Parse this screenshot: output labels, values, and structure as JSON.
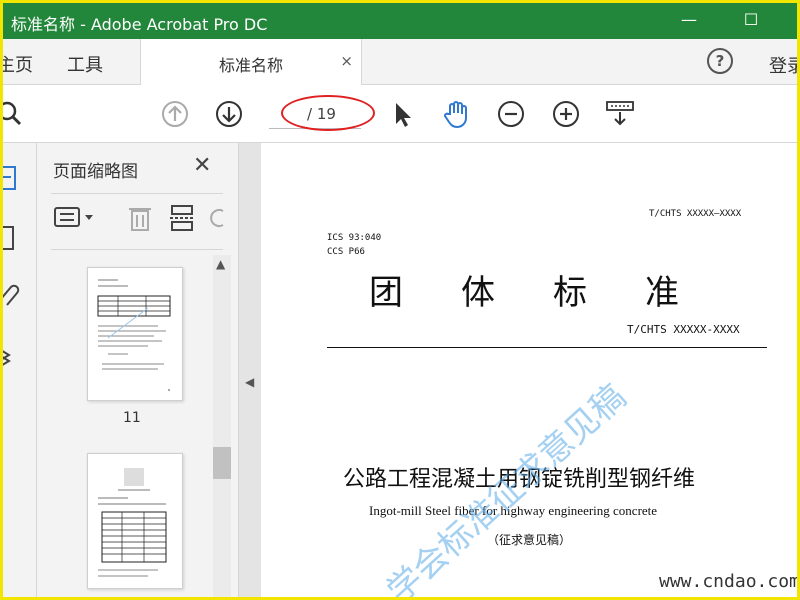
{
  "window": {
    "title": "标准名称 - Adobe Acrobat Pro DC",
    "minimize": "—",
    "maximize": "☐"
  },
  "tabs": {
    "home": "主页",
    "tools": "工具",
    "document": "标准名称",
    "close": "×",
    "help": "?",
    "login": "登录"
  },
  "toolbar": {
    "page_total": "/ 19"
  },
  "panel": {
    "title": "页面缩略图",
    "close": "✕",
    "thumbnails": [
      {
        "label": "11"
      }
    ]
  },
  "document": {
    "code_top": "T/CHTS XXXXX—XXXX",
    "ics": "ICS 93:040",
    "ccs": "CCS P66",
    "heading": "团体标准",
    "code_main": "T/CHTS XXXXX-XXXX",
    "title_cn": "公路工程混凝土用钢锭铣削型钢纤维",
    "title_en": "Ingot-mill Steel fiber for highway engineering concrete",
    "status": "（征求意见稿）",
    "watermark": "学会标准征求意见稿"
  },
  "site": "www.cndao.com",
  "colors": {
    "titlebar": "#22873a",
    "frame": "#f2e600",
    "highlight": "#e02020",
    "accent": "#2f79d1"
  }
}
